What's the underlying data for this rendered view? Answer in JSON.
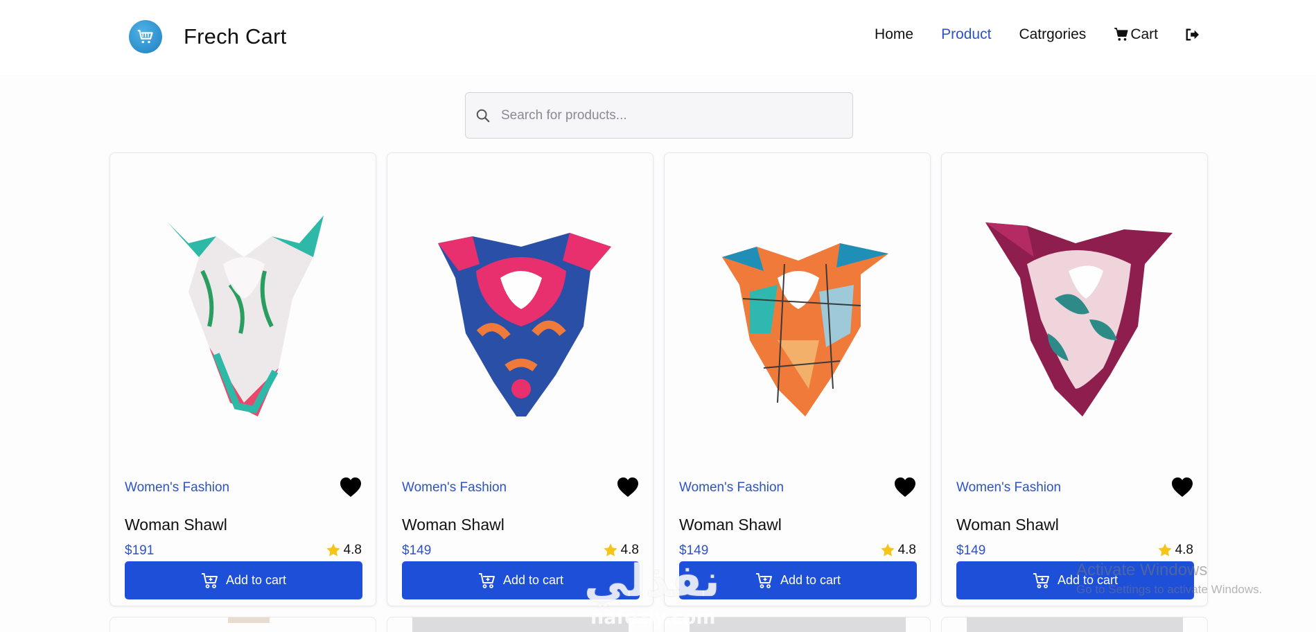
{
  "brand": {
    "name": "Frech Cart",
    "logo_icon": "shopping-cart-icon",
    "logo_color": "#2e93d1"
  },
  "nav": {
    "items": [
      {
        "label": "Home",
        "active": false
      },
      {
        "label": "Product",
        "active": true
      },
      {
        "label": "Catrgories",
        "active": false
      },
      {
        "label": "Cart",
        "active": false,
        "icon": "cart-icon"
      }
    ],
    "logout_icon": "sign-out-icon",
    "active_color": "#2d52c8"
  },
  "search": {
    "placeholder": "Search for products...",
    "value": ""
  },
  "products": [
    {
      "category": "Women's Fashion",
      "title": "Woman Shawl",
      "price": "$191",
      "rating": "4.8",
      "button": "Add to cart",
      "image_icon": "shawl-white-green-image"
    },
    {
      "category": "Women's Fashion",
      "title": "Woman Shawl",
      "price": "$149",
      "rating": "4.8",
      "button": "Add to cart",
      "image_icon": "shawl-pink-blue-image"
    },
    {
      "category": "Women's Fashion",
      "title": "Woman Shawl",
      "price": "$149",
      "rating": "4.8",
      "button": "Add to cart",
      "image_icon": "shawl-orange-teal-image"
    },
    {
      "category": "Women's Fashion",
      "title": "Woman Shawl",
      "price": "$149",
      "rating": "4.8",
      "button": "Add to cart",
      "image_icon": "shawl-magenta-pink-image"
    }
  ],
  "colors": {
    "accent": "#1e4fd9",
    "link": "#2d52c8",
    "star": "#f5c518"
  },
  "overlays": {
    "watermark_arabic": "نفذلي",
    "watermark_url": "nafezly.com",
    "activate_title": "Activate Windows",
    "activate_sub": "Go to Settings to activate Windows."
  }
}
